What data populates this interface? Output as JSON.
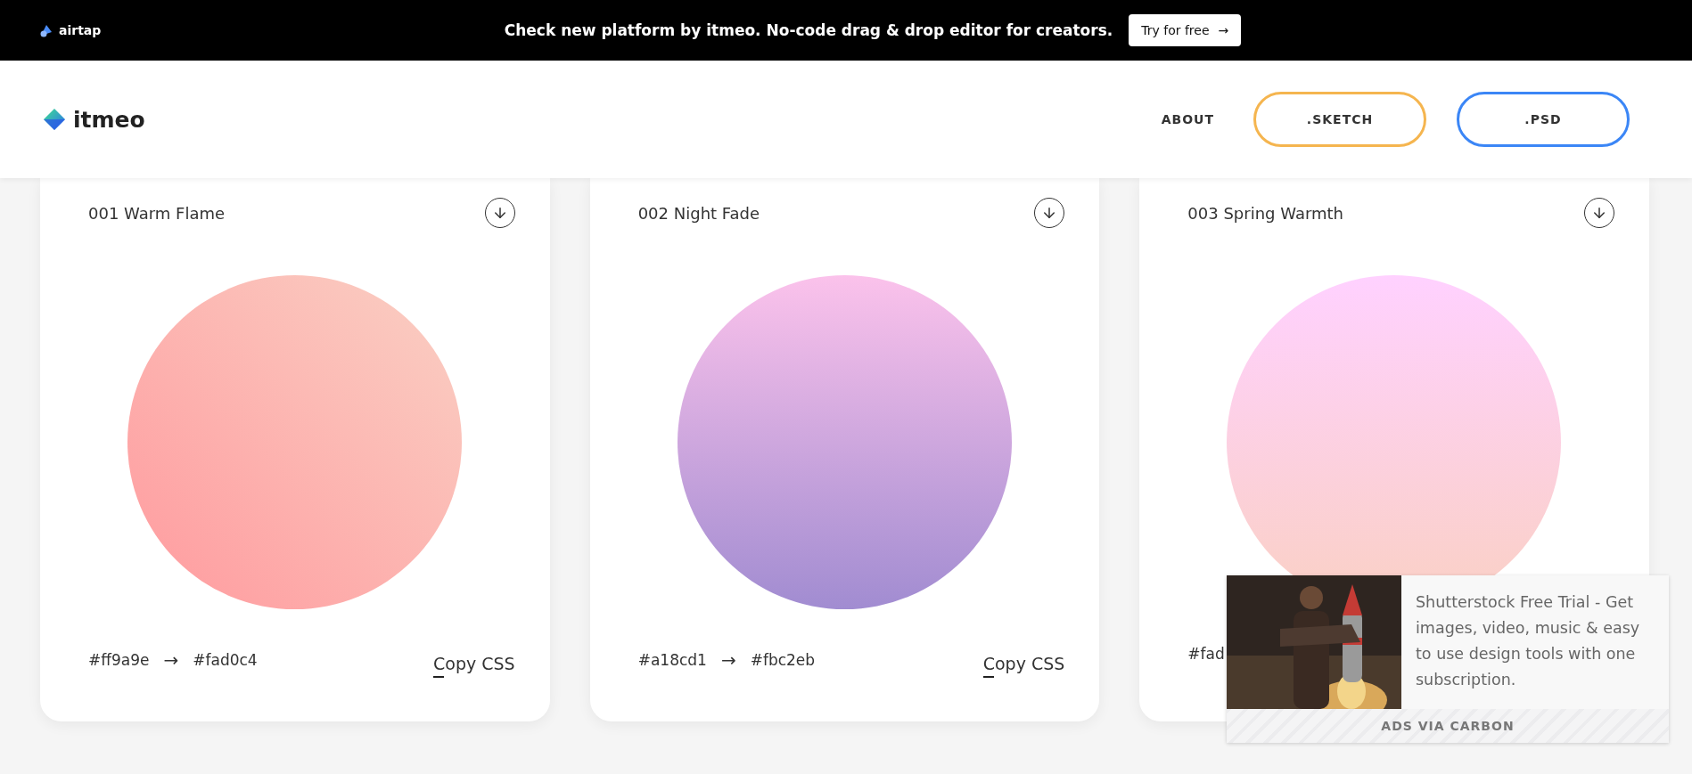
{
  "promo_bar": {
    "brand": "airtap",
    "message": "Check new platform by itmeo. No-code drag & drop editor for creators.",
    "cta": "Try for free",
    "cta_arrow": "→"
  },
  "header": {
    "logo": "itmeo",
    "nav": [
      {
        "label": "ABOUT",
        "kind": "link"
      },
      {
        "label": ".SKETCH",
        "kind": "outline",
        "color": "#f5b54f"
      },
      {
        "label": ".PSD",
        "kind": "outline",
        "color": "#3b86f6"
      }
    ]
  },
  "gradients": [
    {
      "title": "001 Warm Flame",
      "kind": "diagonal",
      "stops": [
        {
          "color": "#ff9a9e"
        },
        {
          "color": "#fad0c4"
        }
      ],
      "from": "#ff9a9e",
      "arrow": "→",
      "to": "#fad0c4",
      "copy": "Copy CSS"
    },
    {
      "title": "002 Night Fade",
      "kind": "vertical",
      "stops": [
        {
          "color": "#a18cd1"
        },
        {
          "color": "#fbc2eb"
        }
      ],
      "from": "#a18cd1",
      "arrow": "→",
      "to": "#fbc2eb",
      "copy": "Copy CSS"
    },
    {
      "title": "003 Spring Warmth",
      "kind": "vertical",
      "stops": [
        {
          "color": "#fad0c4"
        },
        {
          "color": "#ffd1ff"
        }
      ],
      "from": "#fad"
    }
  ],
  "ad": {
    "text": "Shutterstock Free Trial - Get images, video, music & easy to use design tools with one subscription.",
    "footer": "ADS VIA CARBON"
  }
}
